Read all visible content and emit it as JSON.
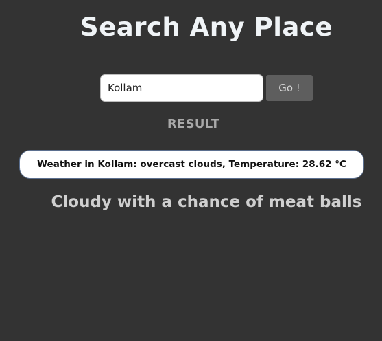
{
  "page": {
    "title": "Search Any Place"
  },
  "search": {
    "value": "Kollam",
    "button_label": "Go !"
  },
  "result": {
    "heading": "RESULT",
    "text": "Weather in Kollam: overcast clouds, Temperature: 28.62 °C"
  },
  "tagline": "Cloudy with a chance of meat balls",
  "colors": {
    "background": "#333333",
    "title": "#f0f4f7",
    "button_bg": "#5e5e5e",
    "result_border": "#5b6f8f"
  }
}
